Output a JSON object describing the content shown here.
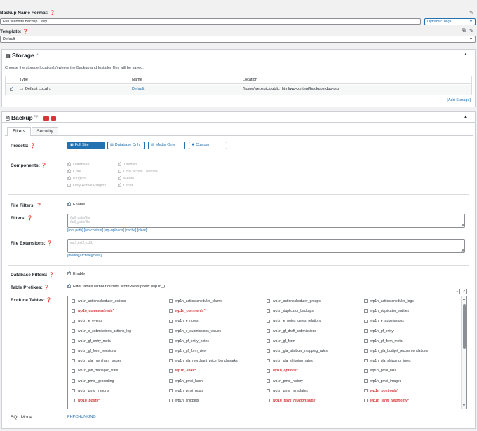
{
  "backup_name": {
    "label": "Backup Name Format:",
    "value": "Full Website backup Daily",
    "dynamic_tags_label": "Dynamic Tags"
  },
  "template": {
    "label": "Template:",
    "value": "Default"
  },
  "storage": {
    "title": "Storage",
    "count": "(1)",
    "description": "Choose the storage location(s) where the Backup and Installer files will be saved.",
    "columns": [
      "Type",
      "Name",
      "Location"
    ],
    "row": {
      "type": "Default Local",
      "name": "Default",
      "location": "/home/webkqic/public_html/wp-content/backups-dup-pro"
    },
    "add_storage": "[Add Storage]"
  },
  "backup": {
    "title": "Backup",
    "sup": "zip",
    "tabs": [
      "Filters",
      "Security"
    ],
    "presets_label": "Presets:",
    "presets": [
      "Full Site",
      "Database Only",
      "Media Only",
      "Custom"
    ],
    "components_label": "Components:",
    "components_left": [
      "Database",
      "Core",
      "Plugins",
      "Only Active Plugins"
    ],
    "components_right": [
      "Themes",
      "Only Active Themes",
      "Media",
      "Other"
    ],
    "file_filters_label": "File Filters:",
    "enable_label": "Enable",
    "filters_label": "Filters:",
    "filters_placeholder_1": "/full_path/dir/",
    "filters_placeholder_2": "/full_path/file;",
    "filters_links": "[root path] [wp-content] [wp-uploads] [cache] [clear]",
    "file_ext_label": "File Extensions:",
    "file_ext_placeholder": "ext1;ext2;ext3;",
    "file_ext_links": "[media][archive][clear]",
    "db_filters_label": "Database Filters:",
    "db_enable_label": "Enable",
    "table_prefixes_label": "Table Prefixes:",
    "table_prefixes_text": "Filter tables without current WordPress prefix (wp1n_)",
    "exclude_tables_label": "Exclude Tables:",
    "tables": [
      [
        "wp1n_actionscheduler_actions",
        "wp1n_actionscheduler_claims",
        "wp1n_actionscheduler_groups",
        "wp1n_actionscheduler_logs"
      ],
      [
        "wp1n_commentmeta*",
        "wp1n_comments*",
        "wp1n_duplicator_backups",
        "wp1n_duplicator_entities"
      ],
      [
        "wp1n_e_events",
        "wp1n_e_notes",
        "wp1n_e_notes_users_relations",
        "wp1n_e_submissions"
      ],
      [
        "wp1n_e_submissions_actions_log",
        "wp1n_e_submissions_values",
        "wp1n_gf_draft_submissions",
        "wp1n_gf_entry"
      ],
      [
        "wp1n_gf_entry_meta",
        "wp1n_gf_entry_notes",
        "wp1n_gf_form",
        "wp1n_gf_form_meta"
      ],
      [
        "wp1n_gf_form_revisions",
        "wp1n_gf_form_view",
        "wp1n_gla_attribute_mapping_rules",
        "wp1n_gla_budget_recommendations"
      ],
      [
        "wp1n_gla_merchant_issues",
        "wp1n_gla_merchant_price_benchmarks",
        "wp1n_gla_shipping_rates",
        "wp1n_gla_shipping_times"
      ],
      [
        "wp1n_job_manager_stats",
        "wp1n_links*",
        "wp1n_options*",
        "wp1n_pmxi_files"
      ],
      [
        "wp1n_pmxi_geocoding",
        "wp1n_pmxi_hash",
        "wp1n_pmxi_history",
        "wp1n_pmxi_images"
      ],
      [
        "wp1n_pmxi_imports",
        "wp1n_pmxi_posts",
        "wp1n_pmxi_templates",
        "wp1n_postmeta*"
      ],
      [
        "wp1n_posts*",
        "wp1n_snippets",
        "wp1n_term_relationships*",
        "wp1n_term_taxonomy*"
      ]
    ],
    "sql_mode_label": "SQL Mode",
    "sql_mode_value": "PHPCHUNKING"
  },
  "colors": {
    "accent": "#2271b1",
    "core_table": "#d63638",
    "storage_icon": "#d63638"
  }
}
